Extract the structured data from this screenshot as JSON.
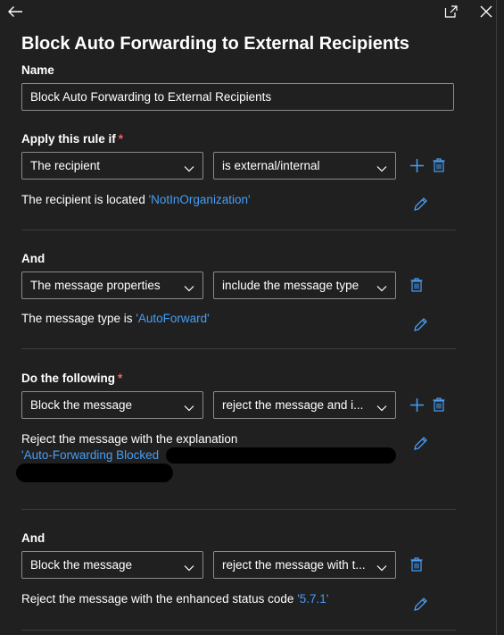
{
  "panel": {
    "title": "Block Auto Forwarding to External Recipients"
  },
  "name_section": {
    "label": "Name",
    "value": "Block Auto Forwarding to External Recipients"
  },
  "conditions": {
    "label": "Apply this rule if",
    "required_mark": "*",
    "first": {
      "left": "The recipient",
      "right": "is external/internal",
      "desc_prefix": "The recipient is located ",
      "desc_link": "'NotInOrganization'"
    },
    "and_label": "And",
    "second": {
      "left": "The message properties",
      "right": "include the message type",
      "desc_prefix": "The message type is ",
      "desc_link": "'AutoForward'"
    }
  },
  "actions": {
    "label": "Do the following",
    "required_mark": "*",
    "first": {
      "left": "Block the message",
      "right": "reject the message and i...",
      "desc_line1": "Reject the message with the explanation",
      "desc_link": "'Auto-Forwarding Blocked"
    },
    "and_label": "And",
    "second": {
      "left": "Block the message",
      "right": "reject the message with t...",
      "desc_prefix": "Reject the message with the enhanced status code ",
      "desc_link": "'5.7.1'"
    }
  },
  "icons": {
    "back": "back-arrow-icon",
    "popout": "open-in-new-window-icon",
    "close": "close-icon",
    "chevron": "chevron-down-icon",
    "add": "add-icon",
    "delete": "trash-icon",
    "edit": "pencil-icon"
  },
  "colors": {
    "background": "#202020",
    "text": "#ffffff",
    "link": "#479ef5",
    "required": "#ff5f5f",
    "divider": "#3b3b3b"
  }
}
